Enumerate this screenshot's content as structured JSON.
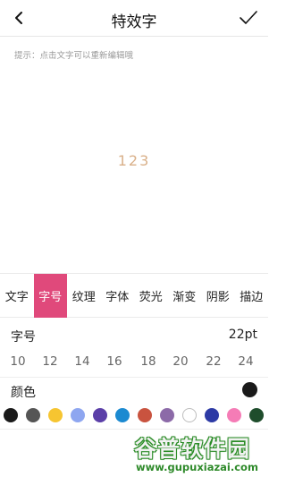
{
  "header": {
    "title": "特效字"
  },
  "hint": "提示：点击文字可以重新编辑哦",
  "preview": {
    "text": "123",
    "color": "#d9b089"
  },
  "tabs": [
    {
      "label": "文字",
      "active": false
    },
    {
      "label": "字号",
      "active": true
    },
    {
      "label": "纹理",
      "active": false
    },
    {
      "label": "字体",
      "active": false
    },
    {
      "label": "荧光",
      "active": false
    },
    {
      "label": "渐变",
      "active": false
    },
    {
      "label": "阴影",
      "active": false
    },
    {
      "label": "描边",
      "active": false
    }
  ],
  "size": {
    "label": "字号",
    "value": "22pt",
    "options": [
      "10",
      "12",
      "14",
      "16",
      "18",
      "20",
      "22",
      "24"
    ]
  },
  "color": {
    "label": "颜色",
    "current": "#1a1a1a",
    "swatches": [
      "#1a1a1a",
      "#555555",
      "#f6c531",
      "#8ea6f0",
      "#5b3fa8",
      "#1c8ad1",
      "#c9533f",
      "#8c6aa8",
      "#ffffff",
      "#2d3aa5",
      "#f57cb6",
      "#1f4d2c"
    ]
  },
  "watermark": {
    "main": "谷普软件园",
    "url": "www.gupuxiazai.com"
  },
  "accent": "#e0497b"
}
